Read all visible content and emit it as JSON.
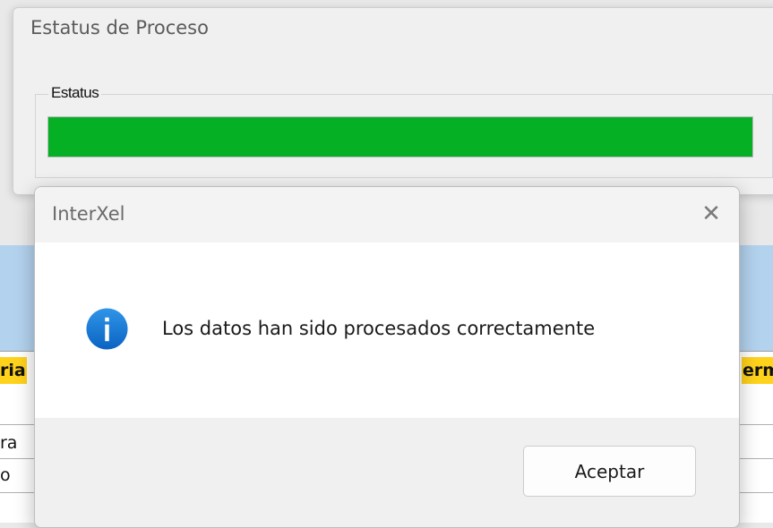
{
  "background_sheet": {
    "header_left_fragment": "ria",
    "header_right_fragment": "erm",
    "row_fragments": [
      "ra",
      "o"
    ]
  },
  "status_window": {
    "title": "Estatus de Proceso",
    "group_label": "Estatus",
    "progress_percent": 100,
    "progress_color": "#06b025"
  },
  "dialog": {
    "title": "InterXel",
    "close_icon": "close-icon",
    "info_icon": "info-icon",
    "message": "Los datos han sido procesados correctamente",
    "ok_label": "Aceptar",
    "accent_color": "#1479d4"
  }
}
